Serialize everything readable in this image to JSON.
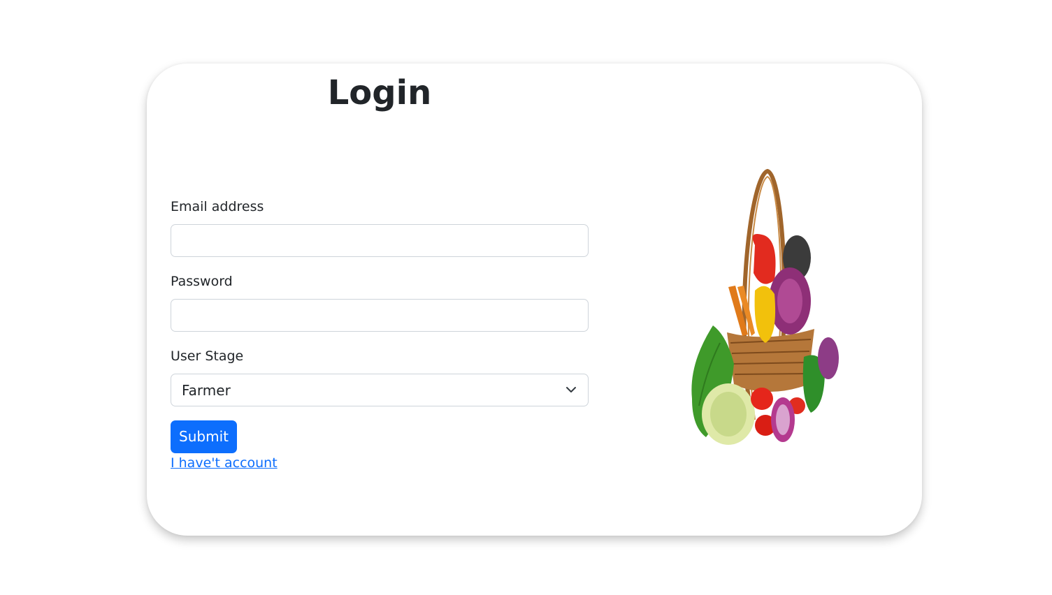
{
  "page": {
    "title": "Login"
  },
  "form": {
    "email_label": "Email address",
    "email_value": "",
    "password_label": "Password",
    "password_value": "",
    "stage_label": "User Stage",
    "stage_selected": "Farmer",
    "submit_label": "Submit",
    "account_link": "I have't account"
  },
  "image": {
    "icon": "vegetable-basket-image"
  },
  "colors": {
    "primary": "#0d6efd",
    "text": "#212529",
    "border": "#ced4da"
  }
}
